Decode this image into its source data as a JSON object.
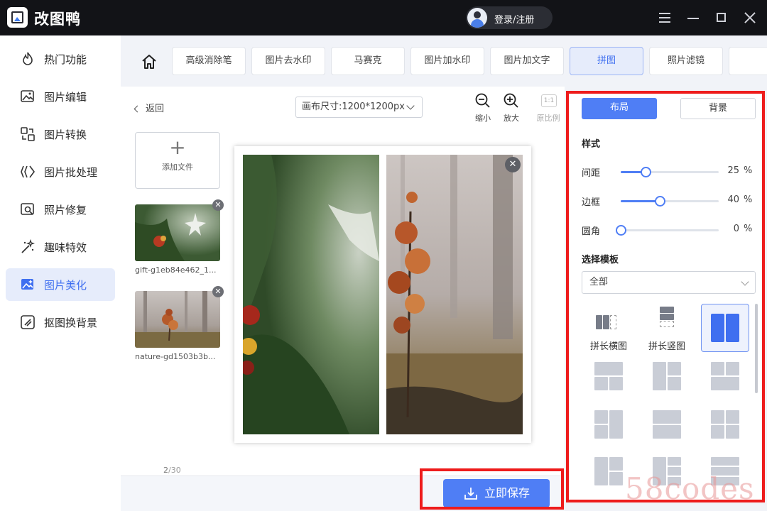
{
  "app": {
    "title": "改图鸭",
    "login_label": "登录/注册"
  },
  "sidebar": {
    "items": [
      {
        "label": "热门功能",
        "icon": "flame-icon"
      },
      {
        "label": "图片编辑",
        "icon": "image-edit-icon"
      },
      {
        "label": "图片转换",
        "icon": "convert-icon"
      },
      {
        "label": "图片批处理",
        "icon": "batch-icon"
      },
      {
        "label": "照片修复",
        "icon": "photo-repair-icon"
      },
      {
        "label": "趣味特效",
        "icon": "magic-wand-icon"
      },
      {
        "label": "图片美化",
        "icon": "beautify-icon",
        "active": true
      },
      {
        "label": "抠图换背景",
        "icon": "cutout-icon"
      }
    ]
  },
  "toolbar": {
    "tools": [
      "高级消除笔",
      "图片去水印",
      "马赛克",
      "图片加水印",
      "图片加文字",
      "拼图",
      "照片滤镜"
    ],
    "active_tool": "拼图"
  },
  "canvas": {
    "back_label": "返回",
    "size_label": "画布尺寸:1200*1200px",
    "zoom_out_label": "缩小",
    "zoom_in_label": "放大",
    "ratio_label": "原比例",
    "ratio_badge": "1:1",
    "add_file_label": "添加文件",
    "files": [
      {
        "name": "gift-g1eb84e462_1..."
      },
      {
        "name": "nature-gd1503b3b..."
      }
    ],
    "page_current": "2",
    "page_total": "/30",
    "save_label": "立即保存"
  },
  "panel": {
    "tab_layout": "布局",
    "tab_background": "背景",
    "style_heading": "样式",
    "sliders": [
      {
        "label": "间距",
        "value": 25,
        "unit": "%"
      },
      {
        "label": "边框",
        "value": 40,
        "unit": "%"
      },
      {
        "label": "圆角",
        "value": 0,
        "unit": "%"
      }
    ],
    "template_heading": "选择模板",
    "template_filter": "全部",
    "templates_labeled": [
      "拼长横图",
      "拼长竖图"
    ]
  },
  "colors": {
    "accent": "#4f7ef5",
    "highlight_frame": "#ee1c1c",
    "titlebar": "#121317"
  },
  "watermark": "58codes"
}
